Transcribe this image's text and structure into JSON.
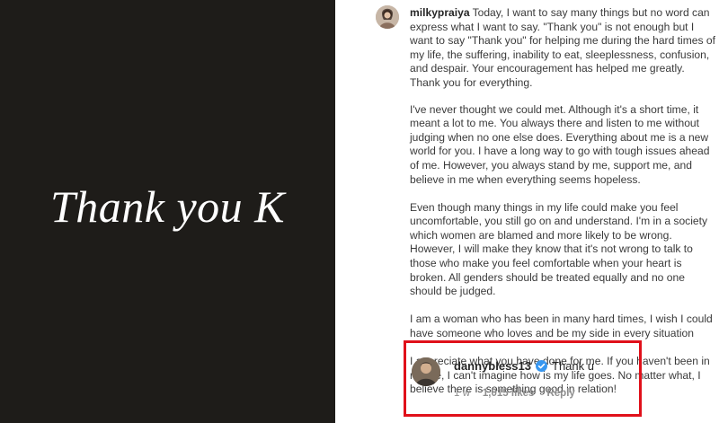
{
  "post": {
    "image_text": "Thank you K"
  },
  "caption": {
    "username": "milkypraiya",
    "paragraphs": [
      "Today, I want to say many things but no word can express what I want to say. \"Thank you\" is not enough but I want to say \"Thank you\" for helping me during the hard times of my life, the suffering, inability to eat, sleeplessness, confusion, and despair. Your encouragement has helped me greatly. Thank you for everything.",
      "I've never thought we could met. Although it's a short time, it meant a lot to me. You always there and listen to me without judging when no one else does. Everything about me is a new world for you. I have a long way to go with tough issues ahead of me. However, you always stand by me, support me, and believe in me when everything seems hopeless.",
      "Even though many things in my life could make you feel uncomfortable, you still go on and understand. I'm in a society which women are blamed and more likely to be wrong. However, I will make they know that it's not wrong to talk to those who make you feel comfortable when your heart is broken. All genders should be treated equally and no one should be judged.",
      "I am a woman who has been in many hard times, I wish I could have someone who loves and be my side in every situation",
      "I appreciate what you have done for me. If you haven't been in my life, I can't imagine how is my life goes. No matter what, I believe there is something good in relation!"
    ]
  },
  "reply": {
    "username": "dannybless13",
    "verified_icon": "verified-badge-icon",
    "text": "Thank u",
    "age": "1 w",
    "likes": "1,015 likes",
    "reply_label": "Reply",
    "highlight_color": "#e0101a"
  }
}
